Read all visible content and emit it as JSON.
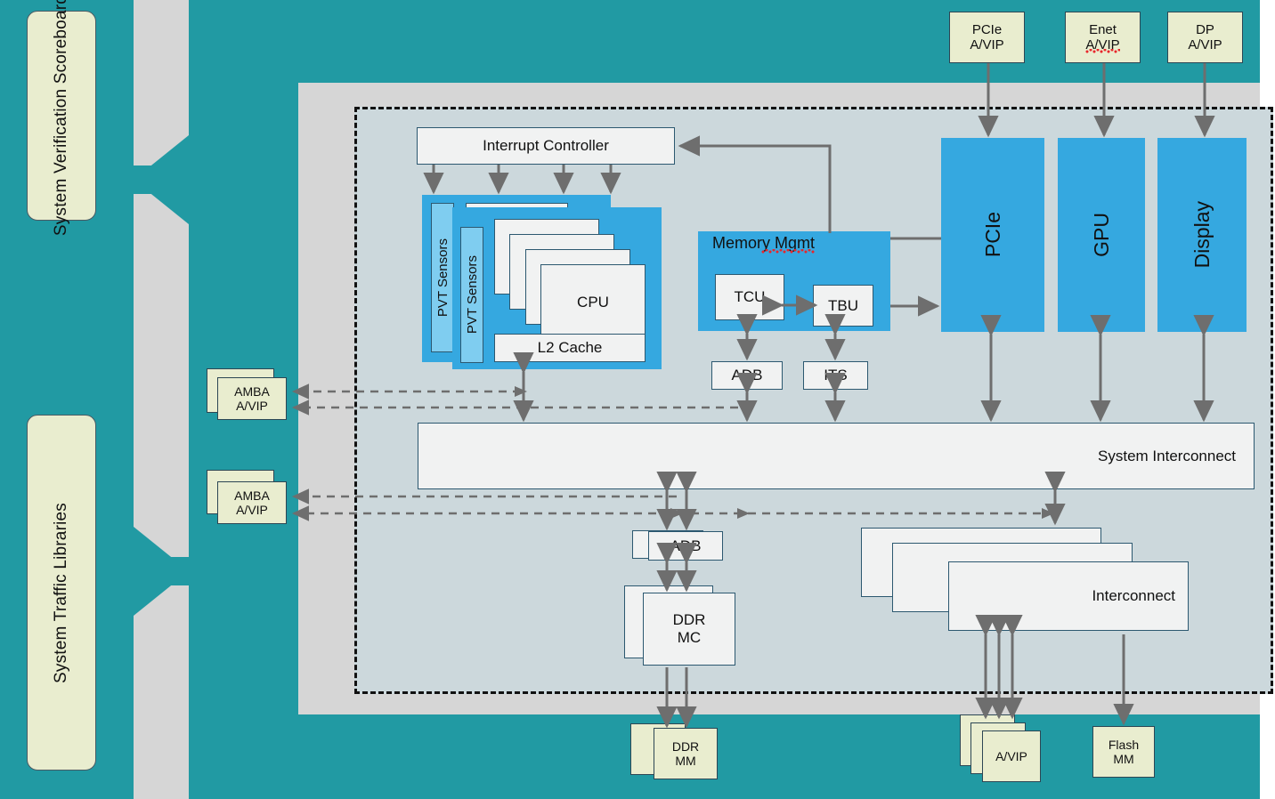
{
  "sidebar": {
    "items": [
      {
        "label": "System Verification Scoreboard",
        "name": "system-verification-scoreboard"
      },
      {
        "label": "System Traffic Libraries",
        "name": "system-traffic-libraries"
      }
    ],
    "arrows": [
      {
        "name": "scoreboard-inbound-arrow",
        "direction": "left"
      },
      {
        "name": "traffic-outbound-arrow",
        "direction": "right"
      }
    ]
  },
  "top_vips": [
    {
      "line1": "PCIe",
      "line2": "A/VIP",
      "misspelled": false
    },
    {
      "line1": "Enet",
      "line2": "A/VIP",
      "misspelled": true
    },
    {
      "line1": "DP",
      "line2": "A/VIP",
      "misspelled": false
    }
  ],
  "left_vips": [
    {
      "line1": "AMBA",
      "line2": "A/VIP"
    },
    {
      "line1": "AMBA",
      "line2": "A/VIP"
    }
  ],
  "bottom_vips": [
    {
      "line1": "DDR",
      "line2": "MM",
      "stack": 2
    },
    {
      "line1": "A/VIP",
      "line2": "",
      "stack": 3
    },
    {
      "line1": "Flash",
      "line2": "MM",
      "stack": 1
    }
  ],
  "soc": {
    "interrupt_controller": "Interrupt Controller",
    "cpu_cluster": {
      "pvt": "PVT Sensors",
      "cpu": "CPU",
      "l2": "L2 Cache",
      "cpu_stack_count": 4,
      "cluster_stack_count": 2
    },
    "memory_mgmt": {
      "title": "Memory Mgmt",
      "title_misspelled": true,
      "tcu": "TCU",
      "tbu": "TBU"
    },
    "adb_top": "ADB",
    "its": "ITS",
    "right_blocks": [
      {
        "label": "PCIe"
      },
      {
        "label": "GPU"
      },
      {
        "label": "Display"
      }
    ],
    "system_interconnect": "System Interconnect",
    "adb_bottom": "ADB",
    "ddr_mc": "DDR\nMC",
    "ddr_mc_line1": "DDR",
    "ddr_mc_line2": "MC",
    "interconnect": "Interconnect",
    "interconnect_stack_count": 3
  },
  "colors": {
    "teal": "#219aa3",
    "gray": "#d6d6d6",
    "soc_fill": "#ccd8dc",
    "block_blue": "#35a8e0",
    "pvt_blue": "#7fcdf0",
    "vip_fill": "#e9edcf",
    "white_fill": "#f1f2f2",
    "box_border": "#2c5870",
    "arrow": "#6e6e6e",
    "spellcheck_red": "#e8262b"
  }
}
